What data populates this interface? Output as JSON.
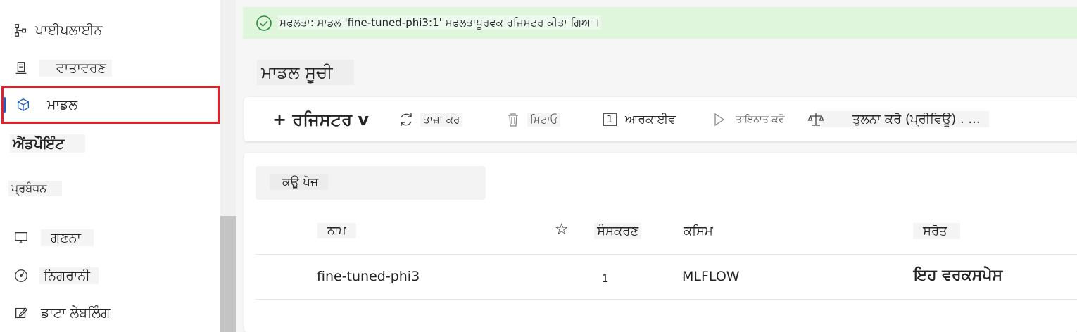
{
  "sidebar": {
    "items": [
      {
        "label": "ਪਾਈਪਲਾਈਨ",
        "icon": "pipeline-icon"
      },
      {
        "label": "ਵਾਤਾਵਰਣ",
        "icon": "environment-icon"
      },
      {
        "label": "ਮਾਡਲ",
        "icon": "model-cube-icon",
        "selected": true
      },
      {
        "label": "ਐਂਡਪੌਇੰਟ"
      }
    ],
    "section_manage": "ਪ੍ਰਬੰਧਨ",
    "manage_items": [
      {
        "label": "ਗਣਨਾ",
        "icon": "compute-icon"
      },
      {
        "label": "ਨਿਗਰਾਨੀ",
        "icon": "monitoring-gauge-icon"
      },
      {
        "label": "ਡਾਟਾ ਲੇਬਲਿੰਗ",
        "icon": "labeling-edit-icon"
      }
    ]
  },
  "banner": {
    "text": "ਸਫਲਤਾ: ਮਾਡਲ 'fine-tuned-phi3:1' ਸਫਲਤਾਪੂਰਵਕ ਰਜਿਸਟਰ ਕੀਤਾ ਗਿਆ।",
    "icon": "success-check-icon"
  },
  "page": {
    "title": "ਮਾਡਲ ਸੂਚੀ"
  },
  "toolbar": {
    "register_label": "+ ਰਜਿਸਟਰ v",
    "refresh_label": "ਤਾਜ਼ਾ ਕਰੋ",
    "delete_label": "ਮਿਟਾਓ",
    "archive_count": "1",
    "archive_label": "ਆਰਕਾਈਵ",
    "deploy_label": "ਤਾਇਨਾਤ ਕਰੋ",
    "compare_label": "ਤੁਲਨਾ ਕਰੋ (ਪ੍ਰੀਵਿਊ) . ..."
  },
  "search": {
    "text": "ਕਉੂ ਖੋਜ"
  },
  "table": {
    "columns": {
      "name": "ਨਾਮ",
      "star": "☆",
      "version": "ਸੰਸਕਰਣ",
      "type": "ਕਸਿਮ",
      "source": "ਸਰੋਤ"
    },
    "rows": [
      {
        "name": "fine-tuned-phi3",
        "version": "1",
        "type": "MLFLOW",
        "source": "ਇਹ ਵਰਕਸਪੇਸ"
      }
    ]
  },
  "colors": {
    "banner_bg": "#dff6dd",
    "highlight_border": "#e0202a",
    "accent": "#1f5fbf"
  }
}
